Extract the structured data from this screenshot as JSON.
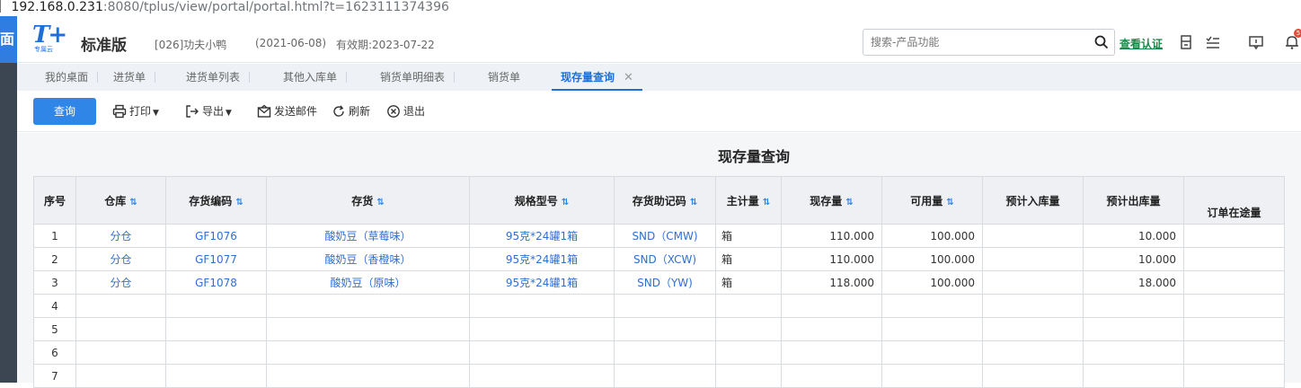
{
  "browser": {
    "url_host": "192.168.0.231",
    "url_rest": ":8080/tplus/view/portal/portal.html?t=1623111374396"
  },
  "left_strip": {
    "glyph": "面"
  },
  "header": {
    "logo_main": "T+",
    "logo_sub": "专属云",
    "edition": "标准版",
    "company": "[026]功夫小鸭",
    "date": "(2021-06-08)",
    "validity": "有效期:2023-07-22",
    "search_placeholder": "搜索-产品功能",
    "verify_link": "查看认证",
    "notification_count": "5"
  },
  "tabs": [
    {
      "label": "我的桌面"
    },
    {
      "label": "进货单"
    },
    {
      "label": "进货单列表"
    },
    {
      "label": "其他入库单"
    },
    {
      "label": "销货单明细表"
    },
    {
      "label": "销货单"
    },
    {
      "label": "现存量查询",
      "active": true
    }
  ],
  "tab_close": "✕",
  "toolbar": {
    "query": "查询",
    "print": "打印",
    "export": "导出",
    "send_mail": "发送邮件",
    "refresh": "刷新",
    "exit": "退出"
  },
  "report": {
    "title": "现存量查询",
    "columns": [
      "序号",
      "仓库",
      "存货编码",
      "存货",
      "规格型号",
      "存货助记码",
      "主计量",
      "现存量",
      "可用量",
      "预计入库量",
      "预计出库量",
      "订单在途量"
    ],
    "rows": [
      {
        "no": "1",
        "warehouse": "分仓",
        "code": "GF1076",
        "item": "酸奶豆（草莓味）",
        "spec": "95克*24罐1箱",
        "mnemonic": "SND（CMW)",
        "unit": "箱",
        "onhand": "110.000",
        "available": "100.000",
        "expected_in": "",
        "expected_out": "10.000",
        "in_transit": ""
      },
      {
        "no": "2",
        "warehouse": "分仓",
        "code": "GF1077",
        "item": "酸奶豆（香橙味）",
        "spec": "95克*24罐1箱",
        "mnemonic": "SND（XCW)",
        "unit": "箱",
        "onhand": "110.000",
        "available": "100.000",
        "expected_in": "",
        "expected_out": "10.000",
        "in_transit": ""
      },
      {
        "no": "3",
        "warehouse": "分仓",
        "code": "GF1078",
        "item": "酸奶豆（原味）",
        "spec": "95克*24罐1箱",
        "mnemonic": "SND（YW)",
        "unit": "箱",
        "onhand": "118.000",
        "available": "100.000",
        "expected_in": "",
        "expected_out": "18.000",
        "in_transit": ""
      },
      {
        "no": "4",
        "warehouse": "",
        "code": "",
        "item": "",
        "spec": "",
        "mnemonic": "",
        "unit": "",
        "onhand": "",
        "available": "",
        "expected_in": "",
        "expected_out": "",
        "in_transit": ""
      },
      {
        "no": "5",
        "warehouse": "",
        "code": "",
        "item": "",
        "spec": "",
        "mnemonic": "",
        "unit": "",
        "onhand": "",
        "available": "",
        "expected_in": "",
        "expected_out": "",
        "in_transit": ""
      },
      {
        "no": "6",
        "warehouse": "",
        "code": "",
        "item": "",
        "spec": "",
        "mnemonic": "",
        "unit": "",
        "onhand": "",
        "available": "",
        "expected_in": "",
        "expected_out": "",
        "in_transit": ""
      },
      {
        "no": "7",
        "warehouse": "",
        "code": "",
        "item": "",
        "spec": "",
        "mnemonic": "",
        "unit": "",
        "onhand": "",
        "available": "",
        "expected_in": "",
        "expected_out": "",
        "in_transit": ""
      }
    ]
  },
  "colors": {
    "brand_blue": "#1f6fd9",
    "query_button": "#2f86e6",
    "link_blue": "#2f6fd0",
    "verify_green": "#1a8a4a",
    "sidebar_dark": "#3c4552"
  },
  "icons": [
    "search-icon",
    "building-icon",
    "checklist-icon",
    "message-icon",
    "bell-icon",
    "print-icon",
    "export-icon",
    "mail-icon",
    "refresh-icon",
    "exit-icon",
    "sort-icon"
  ]
}
